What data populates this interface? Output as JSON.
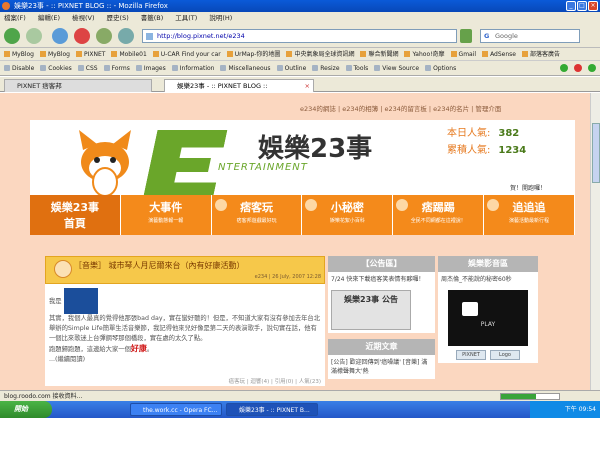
{
  "window": {
    "title": "娛樂23事 - :: PIXNET BLOG :: - Mozilla Firefox"
  },
  "menu": [
    "檔案(F)",
    "編輯(E)",
    "檢視(V)",
    "歷史(S)",
    "書籤(B)",
    "工具(T)",
    "說明(H)"
  ],
  "nav": {
    "url": "http://blog.pixnet.net/e234",
    "search_placeholder": "Google"
  },
  "bookmarks": [
    "MyBlog",
    "MyBlog",
    "PIXNET",
    "Mobile01",
    "U-CAR Find your car",
    "UrMap-你的地圖",
    "中央氣象局全球資訊網",
    "聯合新聞網",
    "Yahoo!奇摩",
    "Gmail",
    "AdSense",
    "部落客廣告"
  ],
  "webdev": [
    "Disable",
    "Cookies",
    "CSS",
    "Forms",
    "Images",
    "Information",
    "Miscellaneous",
    "Outline",
    "Resize",
    "Tools",
    "View Source",
    "Options"
  ],
  "tabs": [
    {
      "label": "PIXNET 痞客邦"
    },
    {
      "label": "娛樂23事 - :: PIXNET BLOG ::"
    }
  ],
  "page": {
    "toplinks": "e234的網誌 | e234的相簿 | e234的留言板 | e234的名片 | 管理介面",
    "site_title": "娛樂23事",
    "subtitle": "NTERTAINMENT",
    "stats": {
      "today_label": "本日人氣:",
      "today_value": "382",
      "total_label": "累積人氣:",
      "total_value": "1234"
    },
    "greeting": "賀！開跑囉！",
    "navitems": [
      {
        "big": "娛樂23事",
        "small": "首頁"
      },
      {
        "big": "大事件",
        "small": "演藝動態報一報"
      },
      {
        "big": "痞客玩",
        "small": "痞客邦遊戲最好玩"
      },
      {
        "big": "小秘密",
        "small": "娛樂花絮小百科"
      },
      {
        "big": "痞踢踢",
        "small": "全民不同網都在這裡說！"
      },
      {
        "big": "追追追",
        "small": "演藝活動最新行程"
      }
    ],
    "article": {
      "title": "［音樂］ 城市琴人月尼爾來台（內有好康活動）",
      "meta": "e234 | 26 July, 2007 12:28",
      "intro": "我是",
      "body": "其實，我個人最真的覺得他那張bad day，實在蠻好聽的！但是，不知道大家有沒有參加去年台北舉辦的Simple Life簡單生活音樂節，我記得他來兒好像是第二天的表演歌手，說句實在話，他有一個比來歌迷上台彈鋼琴那個橋段，實在處的太久了點。",
      "body2": "跑題歸跑題，這邊給大家一個",
      "highlight": "好康",
      "body3": "。",
      "more": "...(繼續閱讀)",
      "footer": "癌客玩 | 迴響(4) | 引用(0) | 人氣(23)"
    },
    "sidebar1": {
      "header": "【公告區】",
      "text": "7/24 快來下載癌客笑表情有夥囉！",
      "img_label": "娛樂23事 公告",
      "recent_header": "近期文章",
      "recent": "[公告] 歡迎回傳到'癌噪議' [音樂] 滿滿檬聲舞大'熱"
    },
    "sidebar2": {
      "header": "娛樂影音區",
      "text": "周杰倫_不能說的秘密60秒",
      "play": "PLAY",
      "logo1": "PIXNET",
      "logo2": "Logo"
    }
  },
  "status": {
    "text": "blog.roodo.com 接收資料..."
  },
  "taskbar": {
    "start": "開始",
    "tasks": [
      "the.work.cc - Opera FC...",
      "娛樂23事 - :: PIXNET B..."
    ],
    "clock": "下午 09:54"
  }
}
